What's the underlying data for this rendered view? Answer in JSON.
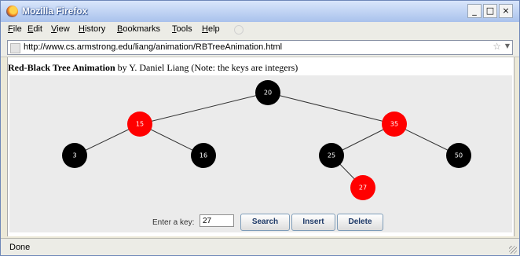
{
  "window": {
    "title": "Mozilla Firefox",
    "buttons": [
      "_",
      "□",
      "×"
    ]
  },
  "menubar": {
    "items": [
      "File",
      "Edit",
      "View",
      "History",
      "Bookmarks",
      "Tools",
      "Help"
    ]
  },
  "navbar": {
    "url": "http://www.cs.armstrong.edu/liang/animation/RBTreeAnimation.html"
  },
  "page": {
    "heading_bold": "Red-Black Tree Animation",
    "heading_rest": " by Y. Daniel Liang (Note: the keys are integers)"
  },
  "tree": {
    "colors": {
      "red": "#ff0000",
      "black": "#000000"
    },
    "nodes": [
      {
        "key": "20",
        "color": "black"
      },
      {
        "key": "15",
        "color": "red"
      },
      {
        "key": "35",
        "color": "red"
      },
      {
        "key": "3",
        "color": "black"
      },
      {
        "key": "16",
        "color": "black"
      },
      {
        "key": "25",
        "color": "black"
      },
      {
        "key": "50",
        "color": "black"
      },
      {
        "key": "27",
        "color": "red"
      }
    ],
    "edges": [
      [
        "20",
        "15"
      ],
      [
        "20",
        "35"
      ],
      [
        "15",
        "3"
      ],
      [
        "15",
        "16"
      ],
      [
        "35",
        "25"
      ],
      [
        "35",
        "50"
      ],
      [
        "25",
        "27"
      ]
    ]
  },
  "controls": {
    "key_label": "Enter a key:",
    "key_value": "27",
    "search_label": "Search",
    "insert_label": "Insert",
    "delete_label": "Delete"
  },
  "statusbar": {
    "text": "Done"
  }
}
